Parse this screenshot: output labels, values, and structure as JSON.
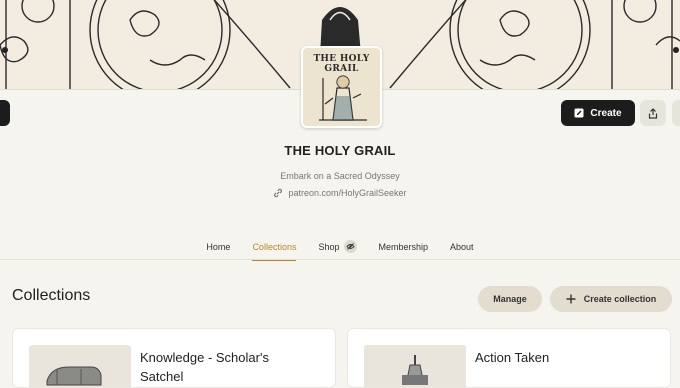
{
  "banner": {
    "avatar_logo_text": "THE HOLY GRAIL"
  },
  "header": {
    "create_label": "Create",
    "creator_name": "THE HOLY GRAIL",
    "tagline": "Embark on a Sacred Odyssey",
    "link": "patreon.com/HolyGrailSeeker"
  },
  "nav": {
    "items": [
      {
        "label": "Home"
      },
      {
        "label": "Collections"
      },
      {
        "label": "Shop"
      },
      {
        "label": "Membership"
      },
      {
        "label": "About"
      }
    ],
    "active": "Collections"
  },
  "collections": {
    "heading": "Collections",
    "manage_label": "Manage",
    "create_label": "Create collection",
    "cards": [
      {
        "title_line1": "Knowledge - Scholar's",
        "title_line2": "Satchel"
      },
      {
        "title_line1": "Action Taken",
        "title_line2": ""
      }
    ]
  },
  "colors": {
    "accent": "#b8872b",
    "dark_button": "#1c1c1c",
    "pill_button": "#e3ddd0"
  },
  "icons": [
    "edit-icon",
    "share-icon",
    "link-icon",
    "eye-off-icon",
    "plus-icon"
  ]
}
